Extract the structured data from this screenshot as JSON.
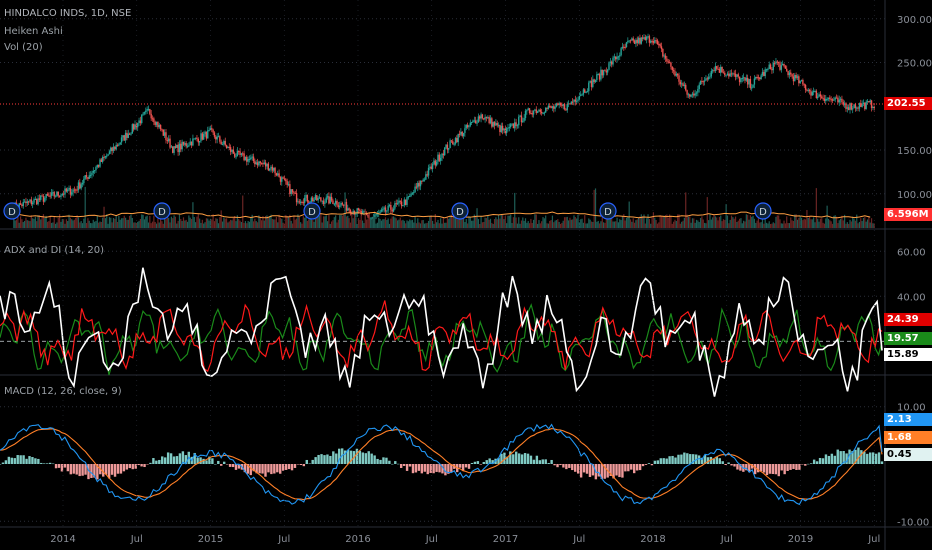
{
  "header": {
    "title": "HINDALCO INDS, 1D, NSE",
    "style": "Heiken Ashi",
    "vol": "Vol (20)"
  },
  "price_badge": "202.55",
  "vol_badge": "6.596M",
  "adx_title": "ADX and DI (14, 20)",
  "macd_title": "MACD (12, 26, close, 9)",
  "dividend_marker": "D",
  "colors": {
    "up": "#26a69a",
    "down": "#ef5350",
    "adx": "#ffffff",
    "diplus": "#ff1a1a",
    "diminus": "#1a8a1a",
    "macd": "#2196f3",
    "signal": "#ff7f27",
    "hist_up": "#80cbc4",
    "hist_down": "#ef9a9a"
  },
  "chart_data": [
    {
      "type": "candlestick",
      "title": "HINDALCO INDS, 1D, NSE",
      "y_ticks": [
        "300.00",
        "250.00",
        "150.00",
        "100.00"
      ],
      "ylim": [
        70,
        310
      ],
      "last_price": 202.55,
      "x_ticks": [
        "2014",
        "Jul",
        "2015",
        "Jul",
        "2016",
        "Jul",
        "2017",
        "Jul",
        "2018",
        "Jul",
        "2019",
        "Jul"
      ],
      "series_anchors": [
        {
          "x": "2013-09",
          "y": 85
        },
        {
          "x": "2014-02",
          "y": 105
        },
        {
          "x": "2014-05",
          "y": 150
        },
        {
          "x": "2014-08",
          "y": 195
        },
        {
          "x": "2014-10",
          "y": 150
        },
        {
          "x": "2015-01",
          "y": 170
        },
        {
          "x": "2015-03",
          "y": 145
        },
        {
          "x": "2015-06",
          "y": 130
        },
        {
          "x": "2015-08",
          "y": 95
        },
        {
          "x": "2015-11",
          "y": 92
        },
        {
          "x": "2016-02",
          "y": 72
        },
        {
          "x": "2016-05",
          "y": 92
        },
        {
          "x": "2016-08",
          "y": 150
        },
        {
          "x": "2016-11",
          "y": 190
        },
        {
          "x": "2017-01",
          "y": 170
        },
        {
          "x": "2017-03",
          "y": 195
        },
        {
          "x": "2017-06",
          "y": 200
        },
        {
          "x": "2017-09",
          "y": 240
        },
        {
          "x": "2017-11",
          "y": 272
        },
        {
          "x": "2018-01",
          "y": 278
        },
        {
          "x": "2018-04",
          "y": 210
        },
        {
          "x": "2018-06",
          "y": 245
        },
        {
          "x": "2018-09",
          "y": 225
        },
        {
          "x": "2018-11",
          "y": 250
        },
        {
          "x": "2019-02",
          "y": 215
        },
        {
          "x": "2019-05",
          "y": 200
        },
        {
          "x": "2019-07",
          "y": 202.55
        }
      ]
    },
    {
      "type": "line",
      "title": "ADX and DI (14, 20)",
      "y_ticks": [
        "60.00",
        "40.00"
      ],
      "ylim": [
        5,
        65
      ],
      "series": [
        {
          "name": "ADX",
          "last": 15.89
        },
        {
          "name": "DI+",
          "last": 24.39
        },
        {
          "name": "DI-",
          "last": 19.57
        }
      ],
      "last_labels": [
        "24.39",
        "19.57",
        "15.89"
      ],
      "threshold": 20
    },
    {
      "type": "line",
      "title": "MACD (12, 26, close, 9)",
      "y_ticks": [
        "10.00",
        "-10.00"
      ],
      "ylim": [
        -11,
        11
      ],
      "series": [
        {
          "name": "MACD",
          "last": 2.13
        },
        {
          "name": "Signal",
          "last": 1.68
        },
        {
          "name": "Histogram",
          "last": 0.45
        }
      ],
      "last_labels": [
        "2.13",
        "1.68",
        "0.45"
      ]
    }
  ]
}
